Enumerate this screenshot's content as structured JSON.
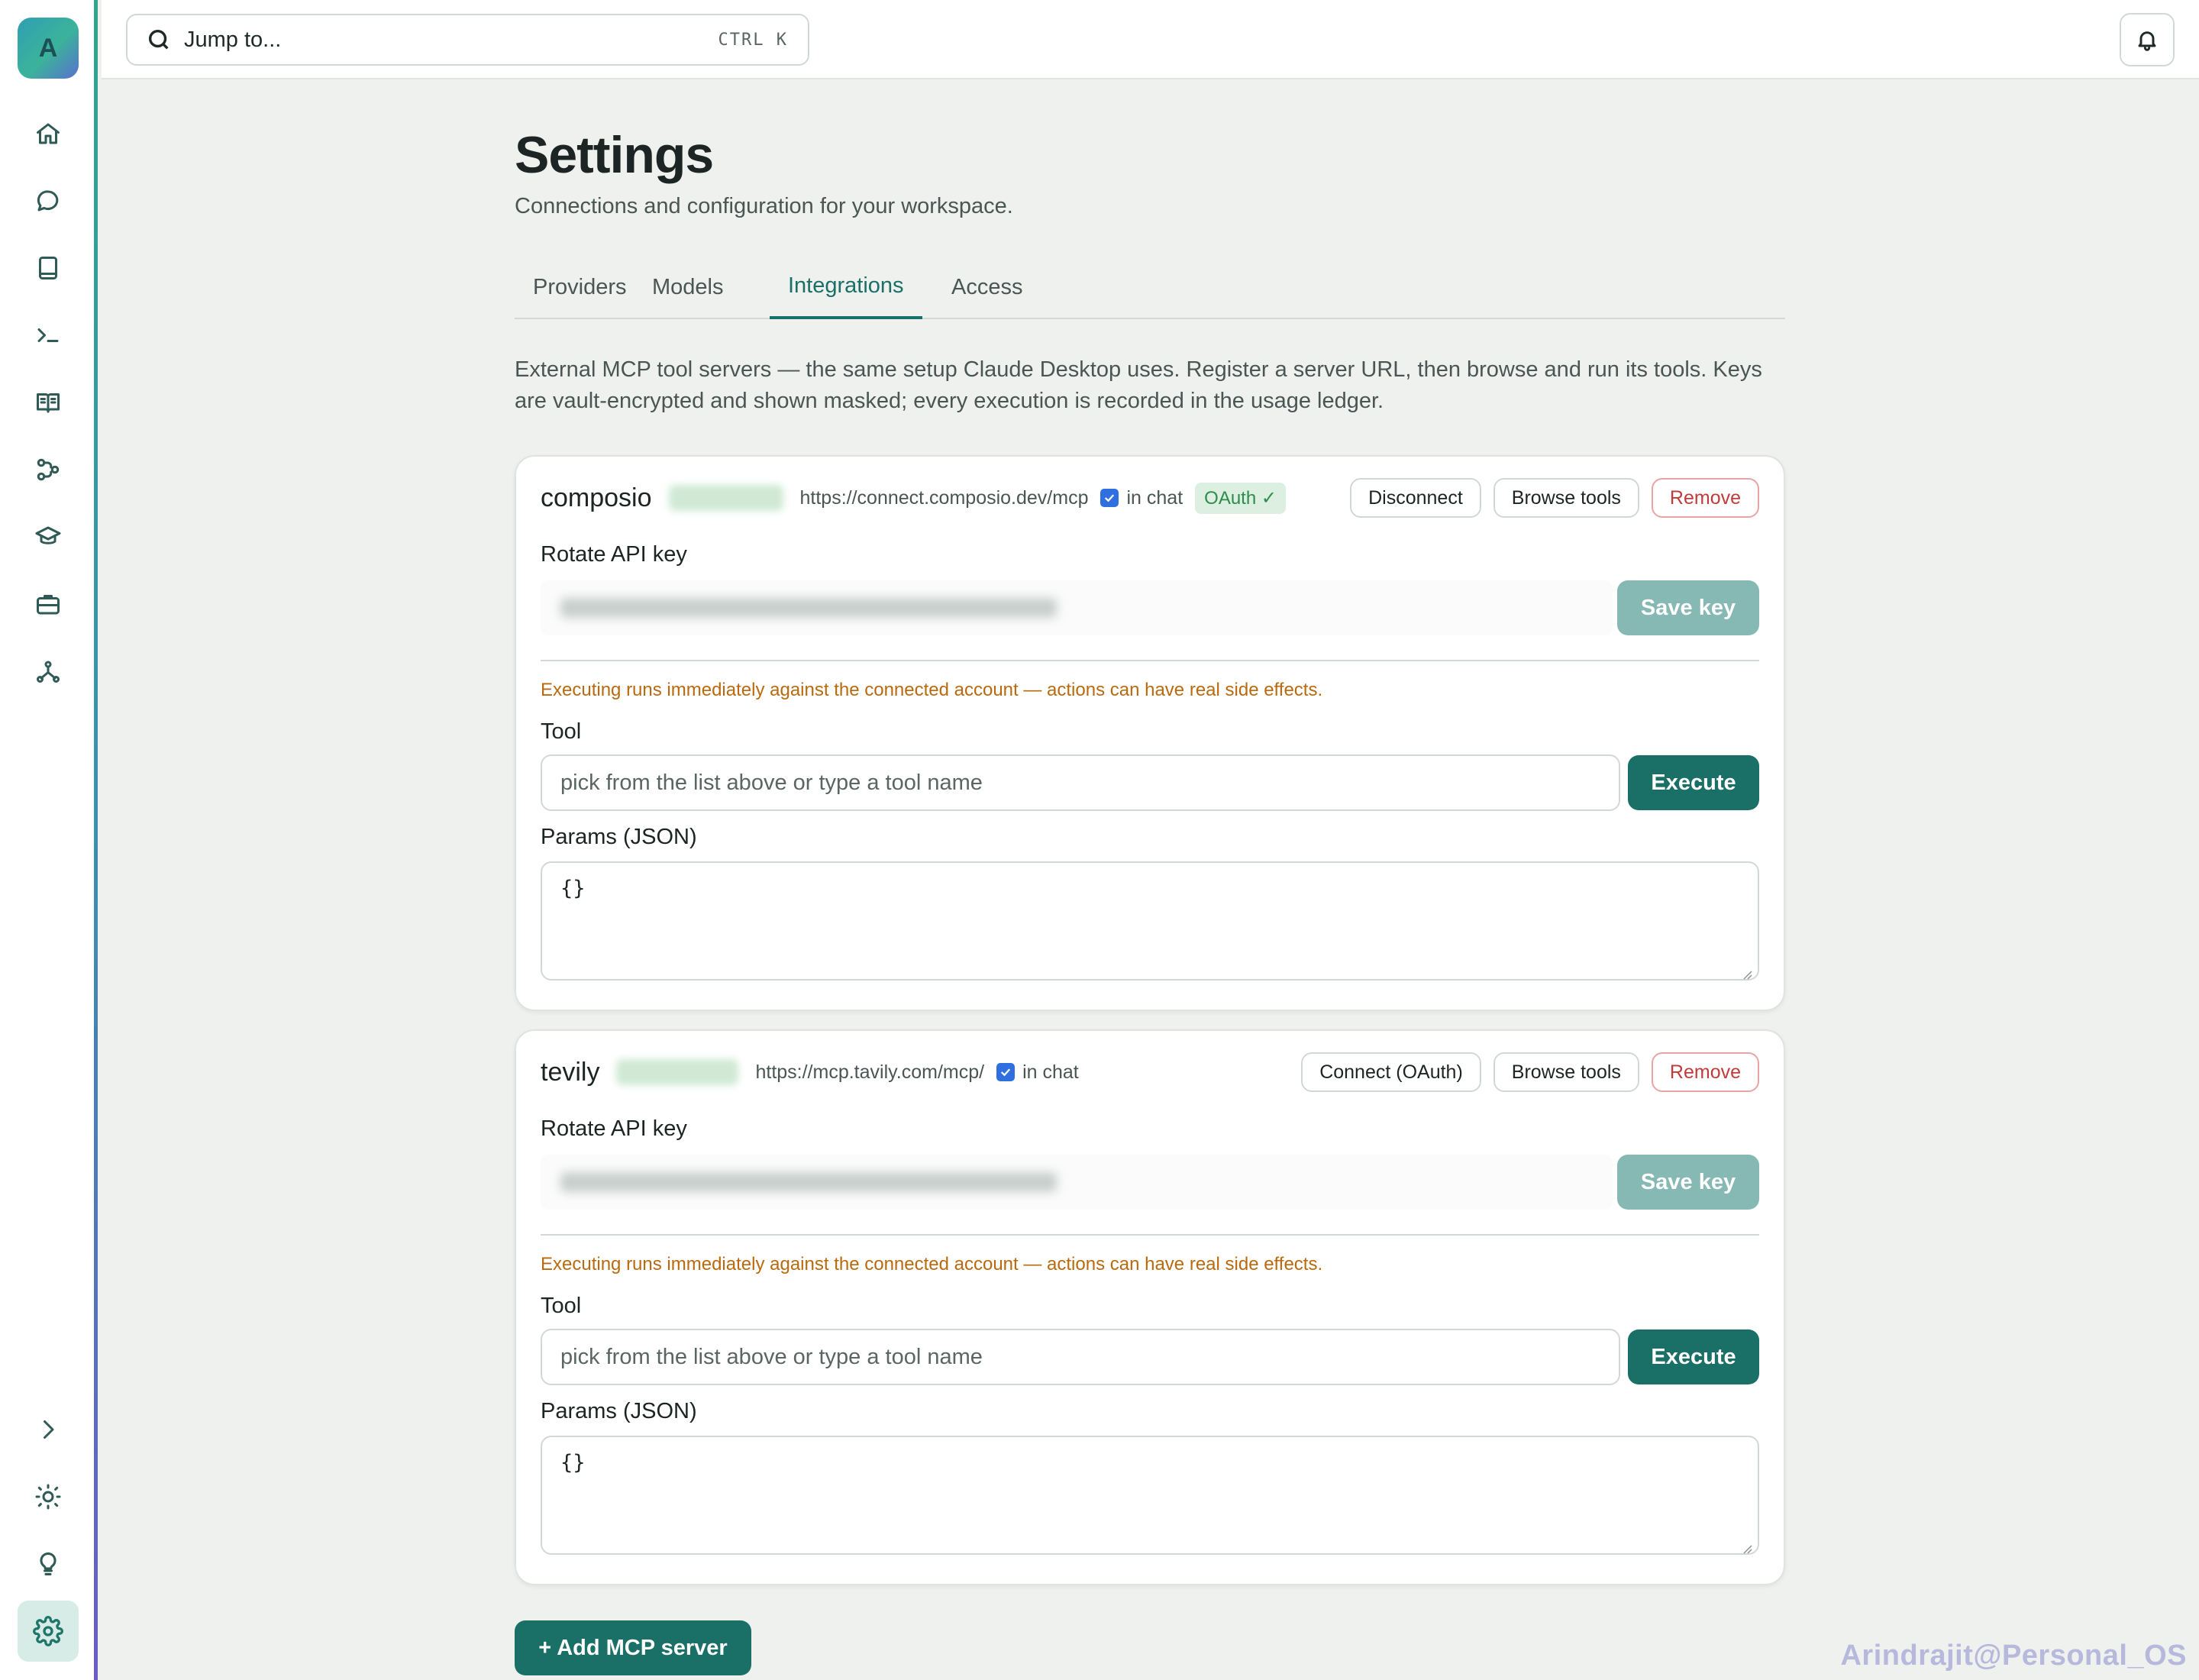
{
  "sidebar": {
    "avatar_letter": "A",
    "items": [
      {
        "icon": "home-icon"
      },
      {
        "icon": "chat-bubble-icon"
      },
      {
        "icon": "notebook-icon"
      },
      {
        "icon": "terminal-icon"
      },
      {
        "icon": "open-book-icon"
      },
      {
        "icon": "workflow-icon"
      },
      {
        "icon": "graduation-cap-icon"
      },
      {
        "icon": "briefcase-icon"
      },
      {
        "icon": "network-icon"
      }
    ],
    "bottom_items": [
      {
        "icon": "chevron-right-icon"
      },
      {
        "icon": "sun-icon"
      },
      {
        "icon": "lightbulb-icon"
      },
      {
        "icon": "settings-gear-icon",
        "active": true
      }
    ]
  },
  "topbar": {
    "search_placeholder": "Jump to...",
    "shortcut": "CTRL K"
  },
  "page": {
    "title": "Settings",
    "subtitle": "Connections and configuration for your workspace.",
    "tabs": [
      {
        "label": "Providers"
      },
      {
        "label": "Models"
      },
      {
        "label": "Integrations",
        "active": true
      },
      {
        "label": "Access"
      }
    ],
    "intro": "External MCP tool servers — the same setup Claude Desktop uses. Register a server URL, then browse and run its tools. Keys are vault-encrypted and shown masked; every execution is recorded in the usage ledger."
  },
  "servers": [
    {
      "name": "composio",
      "url": "https://connect.composio.dev/mcp",
      "in_chat_label": "in chat",
      "in_chat_checked": true,
      "oauth_badge": "OAuth ✓",
      "connect_label": "Disconnect",
      "browse_label": "Browse tools",
      "remove_label": "Remove",
      "rotate_label": "Rotate API key",
      "save_label": "Save key",
      "warning": "Executing runs immediately against the connected account — actions can have real side effects.",
      "tool_label": "Tool",
      "tool_placeholder": "pick from the list above or type a tool name",
      "execute_label": "Execute",
      "params_label": "Params (JSON)",
      "params_value": "{}"
    },
    {
      "name": "tevily",
      "url": "https://mcp.tavily.com/mcp/",
      "in_chat_label": "in chat",
      "in_chat_checked": true,
      "connect_label": "Connect (OAuth)",
      "browse_label": "Browse tools",
      "remove_label": "Remove",
      "rotate_label": "Rotate API key",
      "save_label": "Save key",
      "warning": "Executing runs immediately against the connected account — actions can have real side effects.",
      "tool_label": "Tool",
      "tool_placeholder": "pick from the list above or type a tool name",
      "execute_label": "Execute",
      "params_label": "Params (JSON)",
      "params_value": "{}"
    }
  ],
  "add_server_label": "+ Add MCP server",
  "watermark": "Arindrajit@Personal_OS",
  "colors": {
    "accent": "#1a6f66",
    "save_disabled": "#87b9b4",
    "warning": "#b96a0f",
    "remove": "#c23b3b",
    "background": "#eff1ef"
  }
}
